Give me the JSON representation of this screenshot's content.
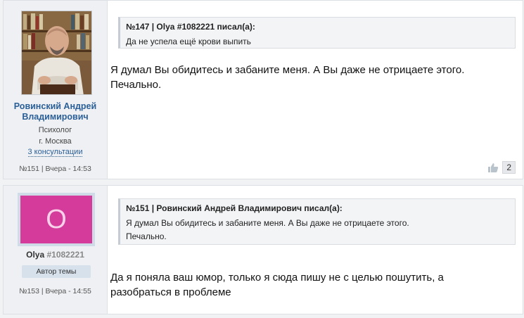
{
  "posts": [
    {
      "author": {
        "name": "Ровинский Андрей Владимирович",
        "role": "Психолог",
        "city": "г. Москва",
        "consultations": "3 консультации",
        "avatar_icon": "person-photo"
      },
      "post_info": "№151 | Вчера - 14:53",
      "quote": {
        "header": "№147 | Olya #1082221 писал(а):",
        "lines": [
          "Да не успела ещё крови выпить"
        ]
      },
      "body_lines": [
        "Я думал Вы обидитесь и забаните меня. А Вы даже не отрицаете этого.",
        "Печально."
      ],
      "likes": {
        "icon": "thumbs-up-icon",
        "count": "2"
      }
    },
    {
      "author": {
        "avatar_letter": "O",
        "name": "Olya",
        "user_id": "#1082221",
        "badge": "Автор темы"
      },
      "post_info": "№153 | Вчера - 14:55",
      "quote": {
        "header": "№151 | Ровинский Андрей Владимирович писал(а):",
        "lines": [
          "Я думал Вы обидитесь и забаните меня. А Вы даже не отрицаете этого.",
          "Печально."
        ]
      },
      "body_lines": [
        "Да я поняла ваш юмор, только я сюда пишу не с целью пошутить, а",
        "разобраться в проблеме"
      ]
    }
  ],
  "colors": {
    "link": "#2b5f97",
    "avatar_bg": "#d43b9a",
    "sidebar_bg": "#eef0f3"
  }
}
